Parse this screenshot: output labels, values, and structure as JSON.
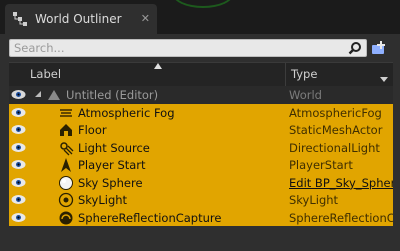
{
  "window": {
    "tab_title": "World Outliner",
    "tab_close_icon": "close-icon"
  },
  "search": {
    "placeholder": "Search...",
    "value": ""
  },
  "columns": {
    "label": "Label",
    "type": "Type"
  },
  "colors": {
    "selected_row": "#e1a500",
    "panel_bg": "#2f2f2f",
    "header_bg": "#242424"
  },
  "rows": [
    {
      "label": "Untitled (Editor)",
      "type": "World",
      "icon": "world-icon",
      "selected": false
    },
    {
      "label": "Atmospheric Fog",
      "type": "AtmosphericFog",
      "icon": "fog-icon",
      "selected": true
    },
    {
      "label": "Floor",
      "type": "StaticMeshActor",
      "icon": "static-mesh-icon",
      "selected": true
    },
    {
      "label": "Light Source",
      "type": "DirectionalLight",
      "icon": "directional-light-icon",
      "selected": true
    },
    {
      "label": "Player Start",
      "type": "PlayerStart",
      "icon": "player-start-icon",
      "selected": true
    },
    {
      "label": "Sky Sphere",
      "type": "Edit BP_Sky_Sphere",
      "icon": "sphere-icon",
      "selected": true
    },
    {
      "label": "SkyLight",
      "type": "SkyLight",
      "icon": "skylight-icon",
      "selected": true
    },
    {
      "label": "SphereReflectionCapture",
      "type": "SphereReflectionCapture",
      "icon": "reflection-capture-icon",
      "selected": true
    }
  ]
}
